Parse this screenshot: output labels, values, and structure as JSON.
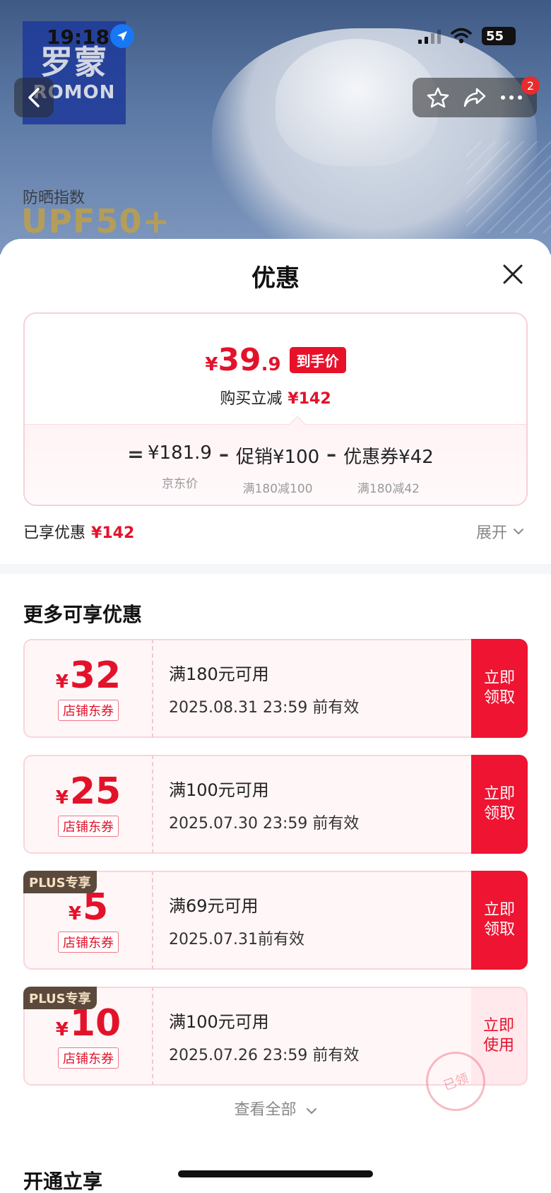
{
  "status_bar": {
    "time": "19:18",
    "battery": "55"
  },
  "background": {
    "brand_cn": "罗蒙",
    "brand_en": "ROMON",
    "upf_label": "防晒指数",
    "upf_value": "UPF50+",
    "cart_badge": "2"
  },
  "sheet": {
    "title": "优惠",
    "final_price": {
      "symbol": "¥",
      "integer": "39",
      "decimal": ".9",
      "tag": "到手价"
    },
    "reduce": {
      "label": "购买立减",
      "amount": "¥142"
    },
    "formula": {
      "equals": "=",
      "minus": "–",
      "terms": [
        {
          "value": "¥181.9",
          "sub": "京东价"
        },
        {
          "value": "促销¥100",
          "sub": "满180减100"
        },
        {
          "value": "优惠券¥42",
          "sub": "满180减42"
        }
      ]
    },
    "enjoyed": {
      "label": "已享优惠",
      "amount": "¥142"
    },
    "expand_label": "展开",
    "more_title": "更多可享优惠",
    "coupons": [
      {
        "symbol": "¥",
        "amount": "32",
        "tag": "店铺东券",
        "plus": "",
        "condition": "满180元可用",
        "expiry": "2025.08.31 23:59 前有效",
        "button": "立即领取"
      },
      {
        "symbol": "¥",
        "amount": "25",
        "tag": "店铺东券",
        "plus": "",
        "condition": "满100元可用",
        "expiry": "2025.07.30 23:59 前有效",
        "button": "立即领取"
      },
      {
        "symbol": "¥",
        "amount": "5",
        "tag": "店铺东券",
        "plus": "PLUS专享",
        "condition": "满69元可用",
        "expiry": "2025.07.31前有效",
        "button": "立即领取"
      },
      {
        "symbol": "¥",
        "amount": "10",
        "tag": "店铺东券",
        "plus": "PLUS专享",
        "condition": "满100元可用",
        "expiry": "2025.07.26 23:59 前有效",
        "button": "立即使用",
        "stamp": "已领"
      }
    ],
    "view_all": "查看全部",
    "bottom_section_title": "开通立享"
  },
  "colors": {
    "accent_red": "#e3122b",
    "button_red": "#ee1432",
    "plus_brown": "#5b4a3c"
  }
}
